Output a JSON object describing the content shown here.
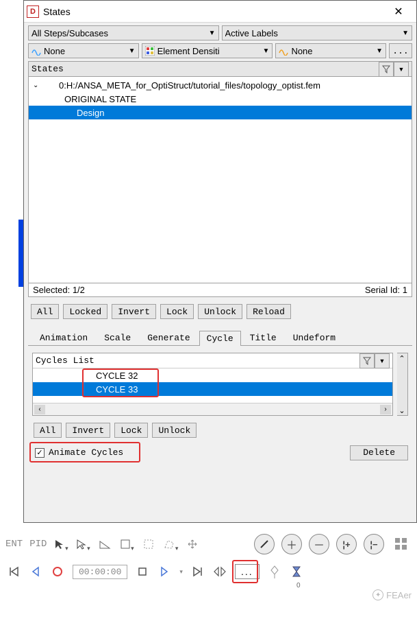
{
  "titlebar": {
    "app_initial": "D",
    "title": "States"
  },
  "filters": {
    "steps": "All Steps/Subcases",
    "labels": "Active Labels",
    "none1": "None",
    "element_density": "Element Densiti",
    "none2": "None",
    "ellipsis": "..."
  },
  "states_panel": {
    "header": "States",
    "tree": {
      "root": "0:H:/ANSA_META_for_OptiStruct/tutorial_files/topology_optist.fem",
      "child1": "ORIGINAL STATE",
      "child2": "Design"
    },
    "status_left": "Selected: 1/2",
    "status_right": "Serial Id: 1",
    "buttons": {
      "all": "All",
      "locked": "Locked",
      "invert": "Invert",
      "lock": "Lock",
      "unlock": "Unlock",
      "reload": "Reload"
    }
  },
  "tabs": {
    "animation": "Animation",
    "scale": "Scale",
    "generate": "Generate",
    "cycle": "Cycle",
    "title": "Title",
    "undeform": "Undeform"
  },
  "cycles": {
    "header": "Cycles List",
    "items": {
      "c32": "CYCLE 32",
      "c33": "CYCLE 33"
    },
    "buttons": {
      "all": "All",
      "invert": "Invert",
      "lock": "Lock",
      "unlock": "Unlock"
    },
    "animate_label": "Animate Cycles",
    "delete": "Delete"
  },
  "bottom": {
    "ent": "ENT",
    "pid": "PID",
    "time": "00:00:00",
    "ellipsis": "...",
    "zero": "0"
  },
  "watermark": {
    "text": "FEAer"
  }
}
